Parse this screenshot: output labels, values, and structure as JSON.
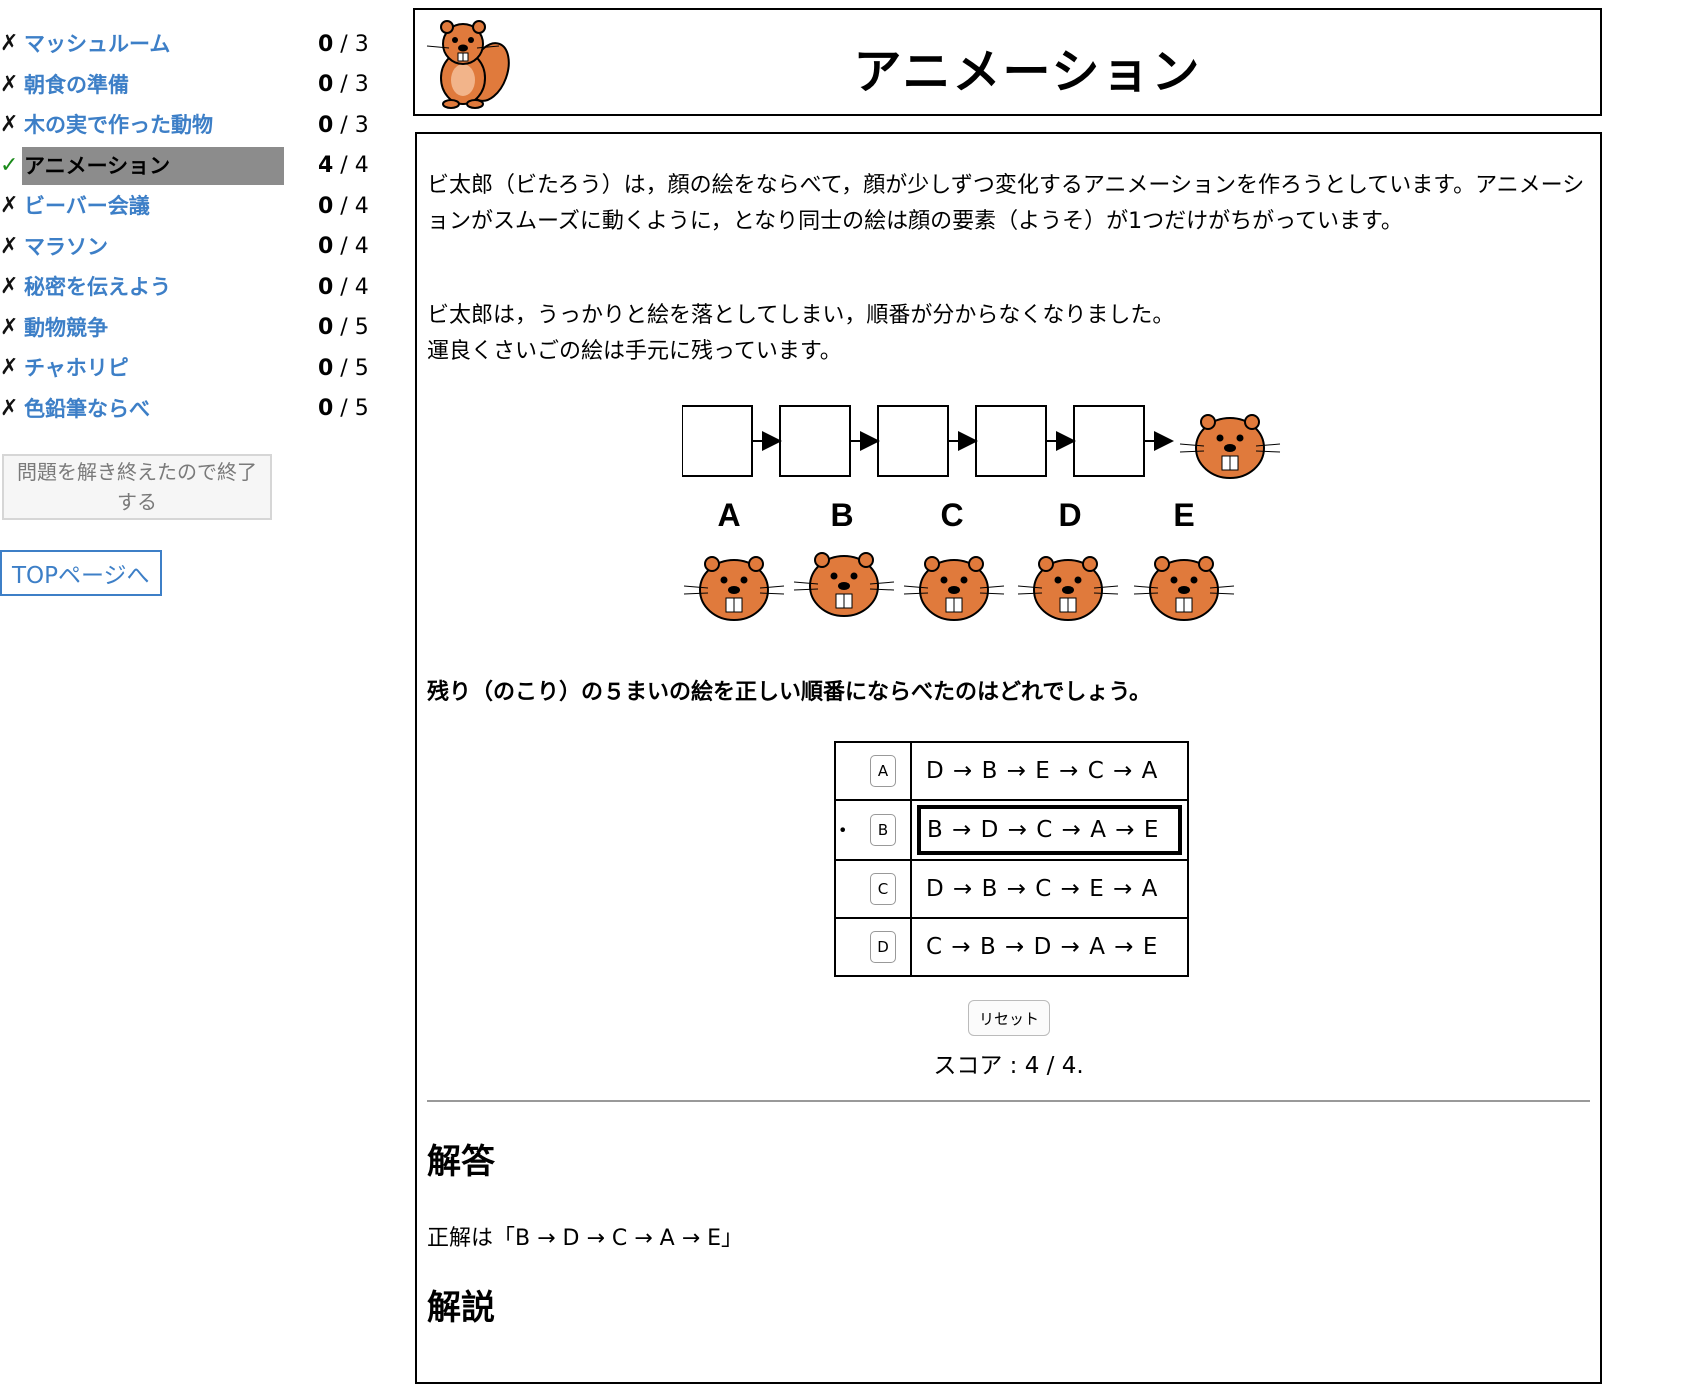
{
  "sidebar": {
    "tasks": [
      {
        "mark": "✗",
        "name": "マッシュルーム",
        "score": "0",
        "max": " / 3"
      },
      {
        "mark": "✗",
        "name": "朝食の準備",
        "score": "0",
        "max": " / 3"
      },
      {
        "mark": "✗",
        "name": "木の実で作った動物",
        "score": "0",
        "max": " / 3"
      },
      {
        "mark": "✓",
        "name": "アニメーション",
        "score": "4",
        "max": " / 4"
      },
      {
        "mark": "✗",
        "name": "ビーバー会議",
        "score": "0",
        "max": " / 4"
      },
      {
        "mark": "✗",
        "name": "マラソン",
        "score": "0",
        "max": " / 4"
      },
      {
        "mark": "✗",
        "name": "秘密を伝えよう",
        "score": "0",
        "max": " / 4"
      },
      {
        "mark": "✗",
        "name": "動物競争",
        "score": "0",
        "max": " / 5"
      },
      {
        "mark": "✗",
        "name": "チャホリピ",
        "score": "0",
        "max": " / 5"
      },
      {
        "mark": "✗",
        "name": "色鉛筆ならべ",
        "score": "0",
        "max": " / 5"
      }
    ],
    "finish_button": "問題を解き終えたので終了する",
    "top_link": "TOPページへ"
  },
  "header": {
    "title": "アニメーション"
  },
  "problem": {
    "para1": "ビ太郎（ビたろう）は，顔の絵をならべて，顔が少しずつ変化するアニメーションを作ろうとしています。アニメーションがスムーズに動くように，となり同士の絵は顔の要素（ようそ）が1つだけがちがっています。",
    "para2_line1": "ビ太郎は，うっかりと絵を落としてしまい，順番が分からなくなりました。",
    "para2_line2": "運良くさいごの絵は手元に残っています。",
    "figure_labels": [
      "A",
      "B",
      "C",
      "D",
      "E"
    ],
    "question": "残り（のこり）の５まいの絵を正しい順番にならべたのはどれでしょう。"
  },
  "options": [
    {
      "key": "A",
      "text": "D → B → E → C → A",
      "selected": false
    },
    {
      "key": "B",
      "text": "B → D → C → A → E",
      "selected": true
    },
    {
      "key": "C",
      "text": "D → B → C → E → A",
      "selected": false
    },
    {
      "key": "D",
      "text": "C → B → D → A → E",
      "selected": false
    }
  ],
  "selected_marker": "•",
  "reset_button": "リセット",
  "score_text": "スコア : 4 / 4.",
  "answer": {
    "heading": "解答",
    "text": "正解は「B → D → C → A → E」",
    "explain_heading": "解説"
  },
  "colors": {
    "link": "#3d7fc7",
    "check": "#1a8a1a",
    "current_bg": "#8c8c8c",
    "beaver": "#e07a3c"
  }
}
